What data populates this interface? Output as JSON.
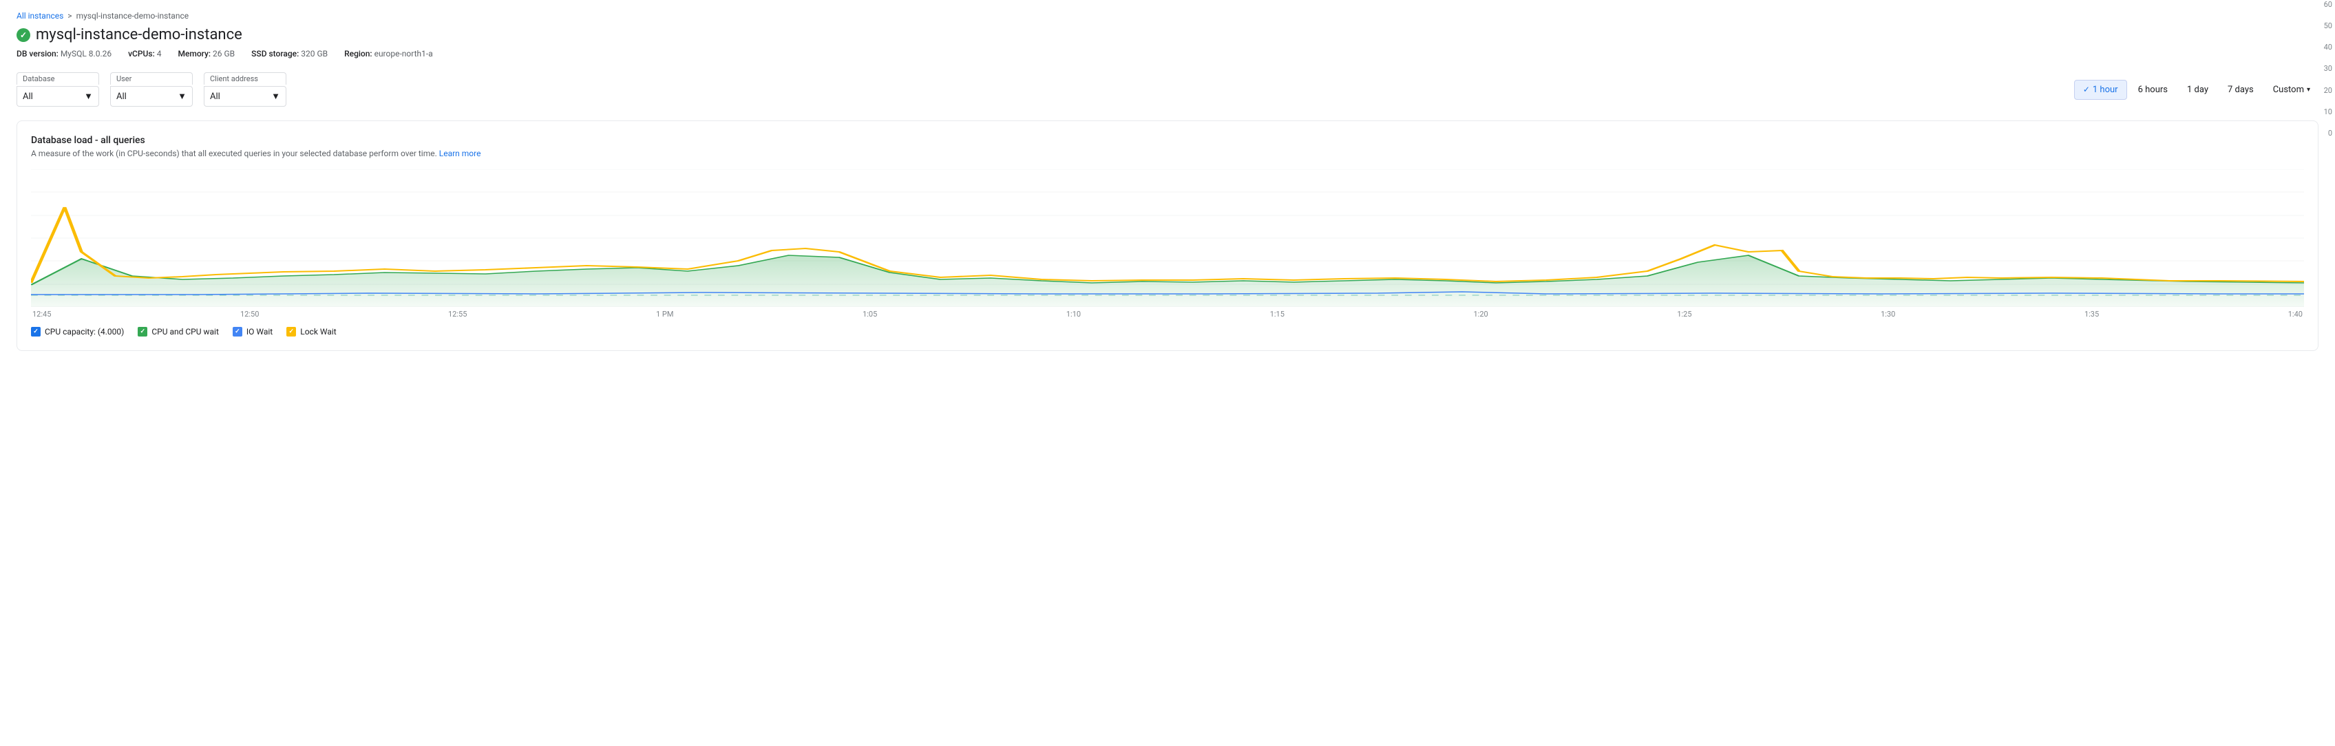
{
  "breadcrumb": {
    "parent_label": "All instances",
    "separator": ">",
    "current": "mysql-instance-demo-instance"
  },
  "instance": {
    "name": "mysql-instance-demo-instance",
    "db_version_label": "DB version:",
    "db_version": "MySQL 8.0.26",
    "vcpus_label": "vCPUs:",
    "vcpus": "4",
    "memory_label": "Memory:",
    "memory": "26 GB",
    "storage_label": "SSD storage:",
    "storage": "320 GB",
    "region_label": "Region:",
    "region": "europe-north1-a"
  },
  "filters": {
    "database": {
      "label": "Database",
      "value": "All"
    },
    "user": {
      "label": "User",
      "value": "All"
    },
    "client_address": {
      "label": "Client address",
      "value": "All"
    }
  },
  "time_range": {
    "options": [
      "1 hour",
      "6 hours",
      "1 day",
      "7 days"
    ],
    "active": "1 hour",
    "custom_label": "Custom"
  },
  "chart": {
    "title": "Database load - all queries",
    "description": "A measure of the work (in CPU-seconds) that all executed queries in your selected database perform over time.",
    "learn_more": "Learn more",
    "y_axis": [
      "60",
      "50",
      "40",
      "30",
      "20",
      "10",
      "0"
    ],
    "x_axis": [
      "12:45",
      "12:50",
      "12:55",
      "1 PM",
      "1:05",
      "1:10",
      "1:15",
      "1:20",
      "1:25",
      "1:30",
      "1:35",
      "1:40"
    ]
  },
  "legend": [
    {
      "id": "cpu-capacity",
      "label": "CPU capacity: (4.000)",
      "color": "#1a73e8",
      "checked": true
    },
    {
      "id": "cpu-wait",
      "label": "CPU and CPU wait",
      "color": "#34a853",
      "checked": true
    },
    {
      "id": "io-wait",
      "label": "IO Wait",
      "color": "#4285f4",
      "checked": true
    },
    {
      "id": "lock-wait",
      "label": "Lock Wait",
      "color": "#fbbc04",
      "checked": true
    }
  ]
}
